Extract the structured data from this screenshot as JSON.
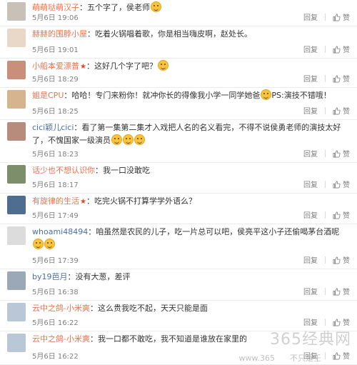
{
  "actions": {
    "reply": "回复",
    "like": "赞"
  },
  "comments": [
    {
      "user": "萌萌哒萌汉子",
      "text": "：五个字了，侯老师",
      "emoji": 1,
      "time": "5月6日 19:06",
      "avatar": "#c9c0b8"
    },
    {
      "user": "赫赫的围脖小屋",
      "text": "：吃着火锅唱着歌，你是相当嗨皮啊，赵处长。",
      "emoji": 0,
      "time": "5月6日 19:01",
      "avatar": "#e9d7c7"
    },
    {
      "user": "小船本爱漂普",
      "vip": "★",
      "text": "：这好几个字了吧？",
      "emoji": 1,
      "time": "5月6日 18:29",
      "avatar": "#c98f7a"
    },
    {
      "user": "姐是CPU",
      "text": "：哈哈！专门来粉你！就冲你长的得像我小学一同学她爸",
      "text2": "PS:演技不错哦！",
      "emoji": 1,
      "time": "5月6日 18:25",
      "avatar": "#d6b58e"
    },
    {
      "user": "cici颖儿cici",
      "text": "：看了第一集第二集才入戏把人名的名义看完，不得不说侯勇老师的演技太好了，不愧国家一级演员",
      "emoji": 3,
      "time": "5月6日 18:23",
      "avatar": "#b88c7c"
    },
    {
      "user": "话少也不想认识你",
      "text": "：我一口没敢吃",
      "emoji": 0,
      "time": "5月6日 18:17",
      "avatar": "#7c8f6a"
    },
    {
      "user": "有旋律的生活",
      "vip": "★",
      "text": "：吃完火锅不打算学学外语么？",
      "emoji": 0,
      "time": "5月6日 17:49",
      "avatar": "#4f6e8f"
    },
    {
      "user": "whoami48494",
      "text": "：咱虽然是农民的儿子，吃一片总可以吧，侯亮平这小子还偷喝茅台酒呢",
      "emoji": 2,
      "time": "5月6日 17:39",
      "avatar": "#dcdcdc"
    },
    {
      "user": "by19芭月",
      "text": "：没有大葱，差评",
      "emoji": 0,
      "time": "5月6日 16:38",
      "avatar": "#9aa8b8"
    },
    {
      "user": "云中之鸽-小米爽",
      "text": "：这么贵我吃不起，天天只能是面",
      "emoji": 0,
      "time": "5月6日 16:22",
      "avatar": "#b9c7d6"
    },
    {
      "user": "云中之鸽-小米爽",
      "text": "：我一口都不敢吃，我不知道是谁放在家里的",
      "emoji": 0,
      "time": "5月6日 16:22",
      "avatar": "#b9c7d6"
    }
  ],
  "watermark": {
    "main": "365经典网",
    "sub": "www.365",
    "corner": "不只是壬"
  }
}
